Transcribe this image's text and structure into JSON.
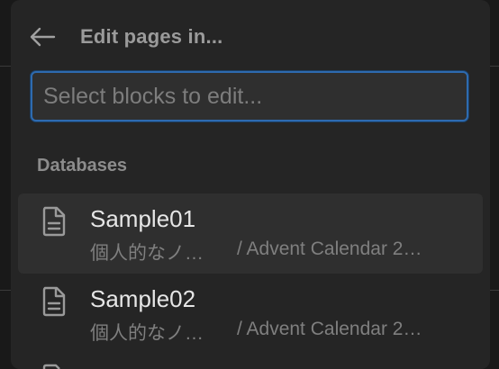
{
  "header": {
    "title": "Edit pages in..."
  },
  "search": {
    "placeholder": "Select blocks to edit..."
  },
  "section": {
    "label": "Databases"
  },
  "items": [
    {
      "title": "Sample01",
      "path_left": "個人的なノ…",
      "path_right": "/ Advent Calendar 2…",
      "icon": "document-icon",
      "highlighted": true
    },
    {
      "title": "Sample02",
      "path_left": "個人的なノ…",
      "path_right": "/ Advent Calendar 2…",
      "icon": "document-icon",
      "highlighted": false
    }
  ],
  "colors": {
    "panel_bg": "#252525",
    "focus_border": "#2e6bb0",
    "hover_bg": "#2f2f2f"
  }
}
